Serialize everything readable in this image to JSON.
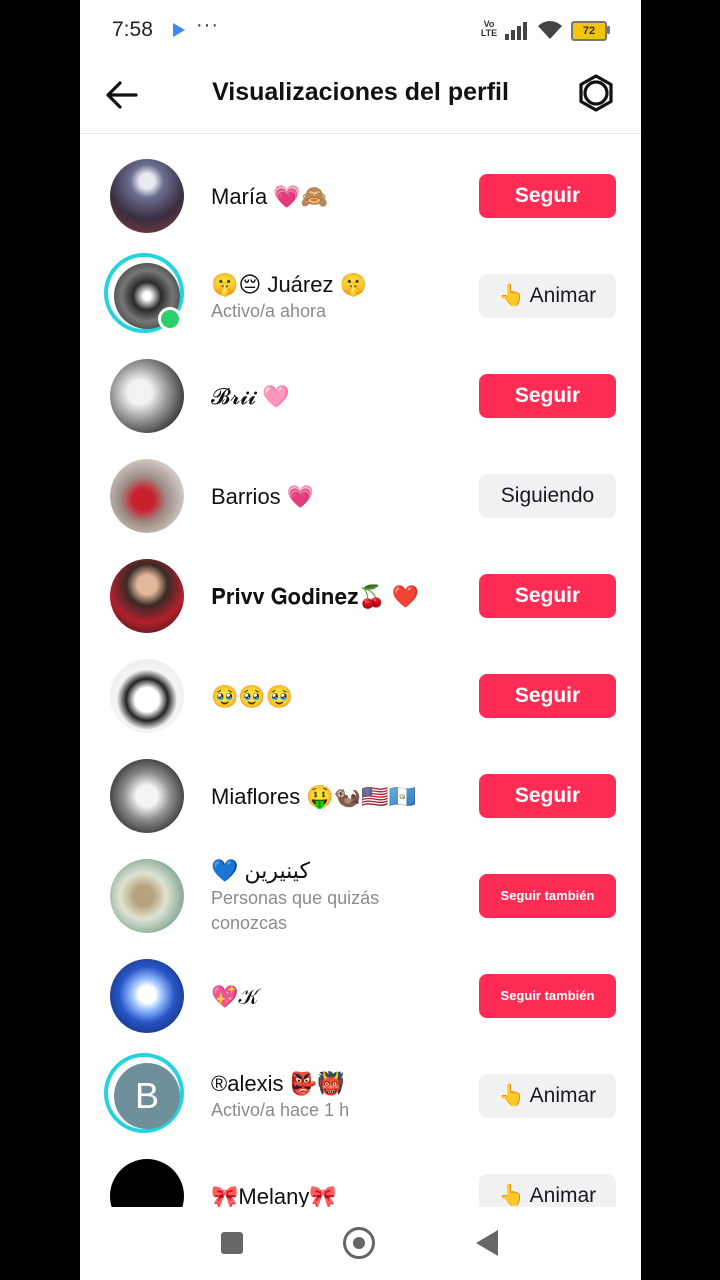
{
  "status_bar": {
    "time": "7:58",
    "more": "···",
    "network": "Vo LTE",
    "battery": "72"
  },
  "header": {
    "title": "Visualizaciones del perfil"
  },
  "colors": {
    "accent": "#fe2c55",
    "online": "#2ad06b",
    "story_ring": "#23d3dd"
  },
  "rows": [
    {
      "name": "María 💗🙈",
      "button": "Seguir"
    },
    {
      "name": "🤫😔 Juárez 🤫",
      "status": "Activo/a ahora",
      "button": "👆 Animar"
    },
    {
      "name": "𝓑𝓻𝓲𝓲 🩷",
      "button": "Seguir"
    },
    {
      "name": "Barrios 💗",
      "button": "Siguiendo"
    },
    {
      "name": "𝐏𝐫𝐢𝐯𝐯 𝐆𝐨𝐝𝐢𝐧𝐞𝐳🍒 ❤️",
      "button": "Seguir"
    },
    {
      "name": "🥹🥹🥹",
      "button": "Seguir"
    },
    {
      "name": "Miaflores 🤑🦦🇺🇸🇬🇹",
      "button": "Seguir"
    },
    {
      "name": "💙 كينيرين",
      "status": "Personas que quizás conozcas",
      "button": "Seguir también"
    },
    {
      "name": "💖𝒦",
      "button": "Seguir también"
    },
    {
      "name": "®alexis 👺👹",
      "status": "Activo/a hace 1 h",
      "button": "👆 Animar",
      "avatar_letter": "B"
    },
    {
      "name": "🎀Melany🎀",
      "button": "👆 Animar"
    }
  ]
}
